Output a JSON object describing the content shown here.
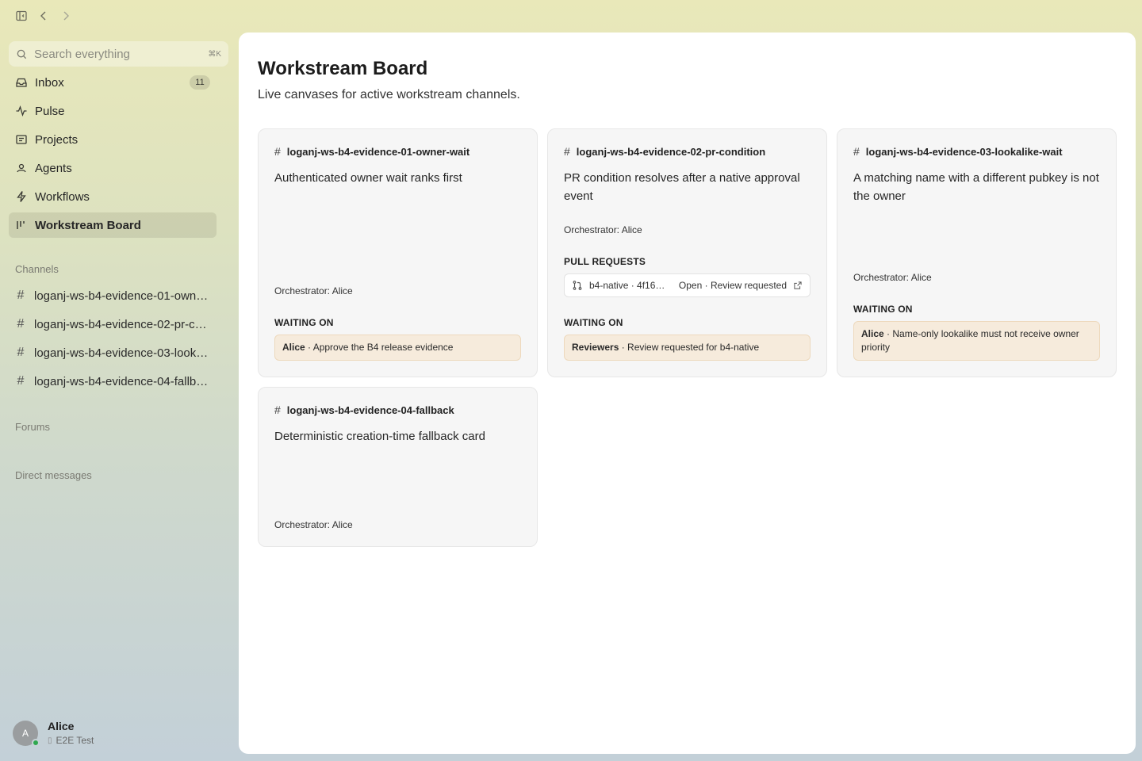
{
  "search": {
    "placeholder": "Search everything",
    "shortcut": "⌘K"
  },
  "nav": {
    "items": [
      {
        "label": "Inbox",
        "badge": "11"
      },
      {
        "label": "Pulse"
      },
      {
        "label": "Projects"
      },
      {
        "label": "Agents"
      },
      {
        "label": "Workflows"
      },
      {
        "label": "Workstream Board"
      }
    ]
  },
  "sections": {
    "channels": "Channels",
    "forums": "Forums",
    "dms": "Direct messages"
  },
  "channels": [
    "loganj-ws-b4-evidence-01-owner-wait",
    "loganj-ws-b4-evidence-02-pr-condition",
    "loganj-ws-b4-evidence-03-lookalike-wait",
    "loganj-ws-b4-evidence-04-fallback"
  ],
  "user": {
    "name": "Alice",
    "status": "E2E Test",
    "initial": "A"
  },
  "page": {
    "title": "Workstream Board",
    "subtitle": "Live canvases for active workstream channels."
  },
  "labels": {
    "waiting_on": "WAITING ON",
    "pull_requests": "PULL REQUESTS"
  },
  "cards": [
    {
      "channel": "loganj-ws-b4-evidence-01-owner-wait",
      "title": "Authenticated owner wait ranks first",
      "orchestrator": "Orchestrator: Alice",
      "wait_who": "Alice",
      "wait_text": " · Approve the B4 release evidence"
    },
    {
      "channel": "loganj-ws-b4-evidence-02-pr-condition",
      "title": "PR condition resolves after a native approval event",
      "orchestrator": "Orchestrator: Alice",
      "pr_ref": "b4-native · 4f168ef...",
      "pr_state": "Open · Review requested",
      "wait_who": "Reviewers",
      "wait_text": " · Review requested for b4-native"
    },
    {
      "channel": "loganj-ws-b4-evidence-03-lookalike-wait",
      "title": "A matching name with a different pubkey is not the owner",
      "orchestrator": "Orchestrator: Alice",
      "wait_who": "Alice",
      "wait_text": " · Name-only lookalike must not receive owner priority"
    },
    {
      "channel": "loganj-ws-b4-evidence-04-fallback",
      "title": "Deterministic creation-time fallback card",
      "orchestrator": "Orchestrator: Alice"
    }
  ]
}
